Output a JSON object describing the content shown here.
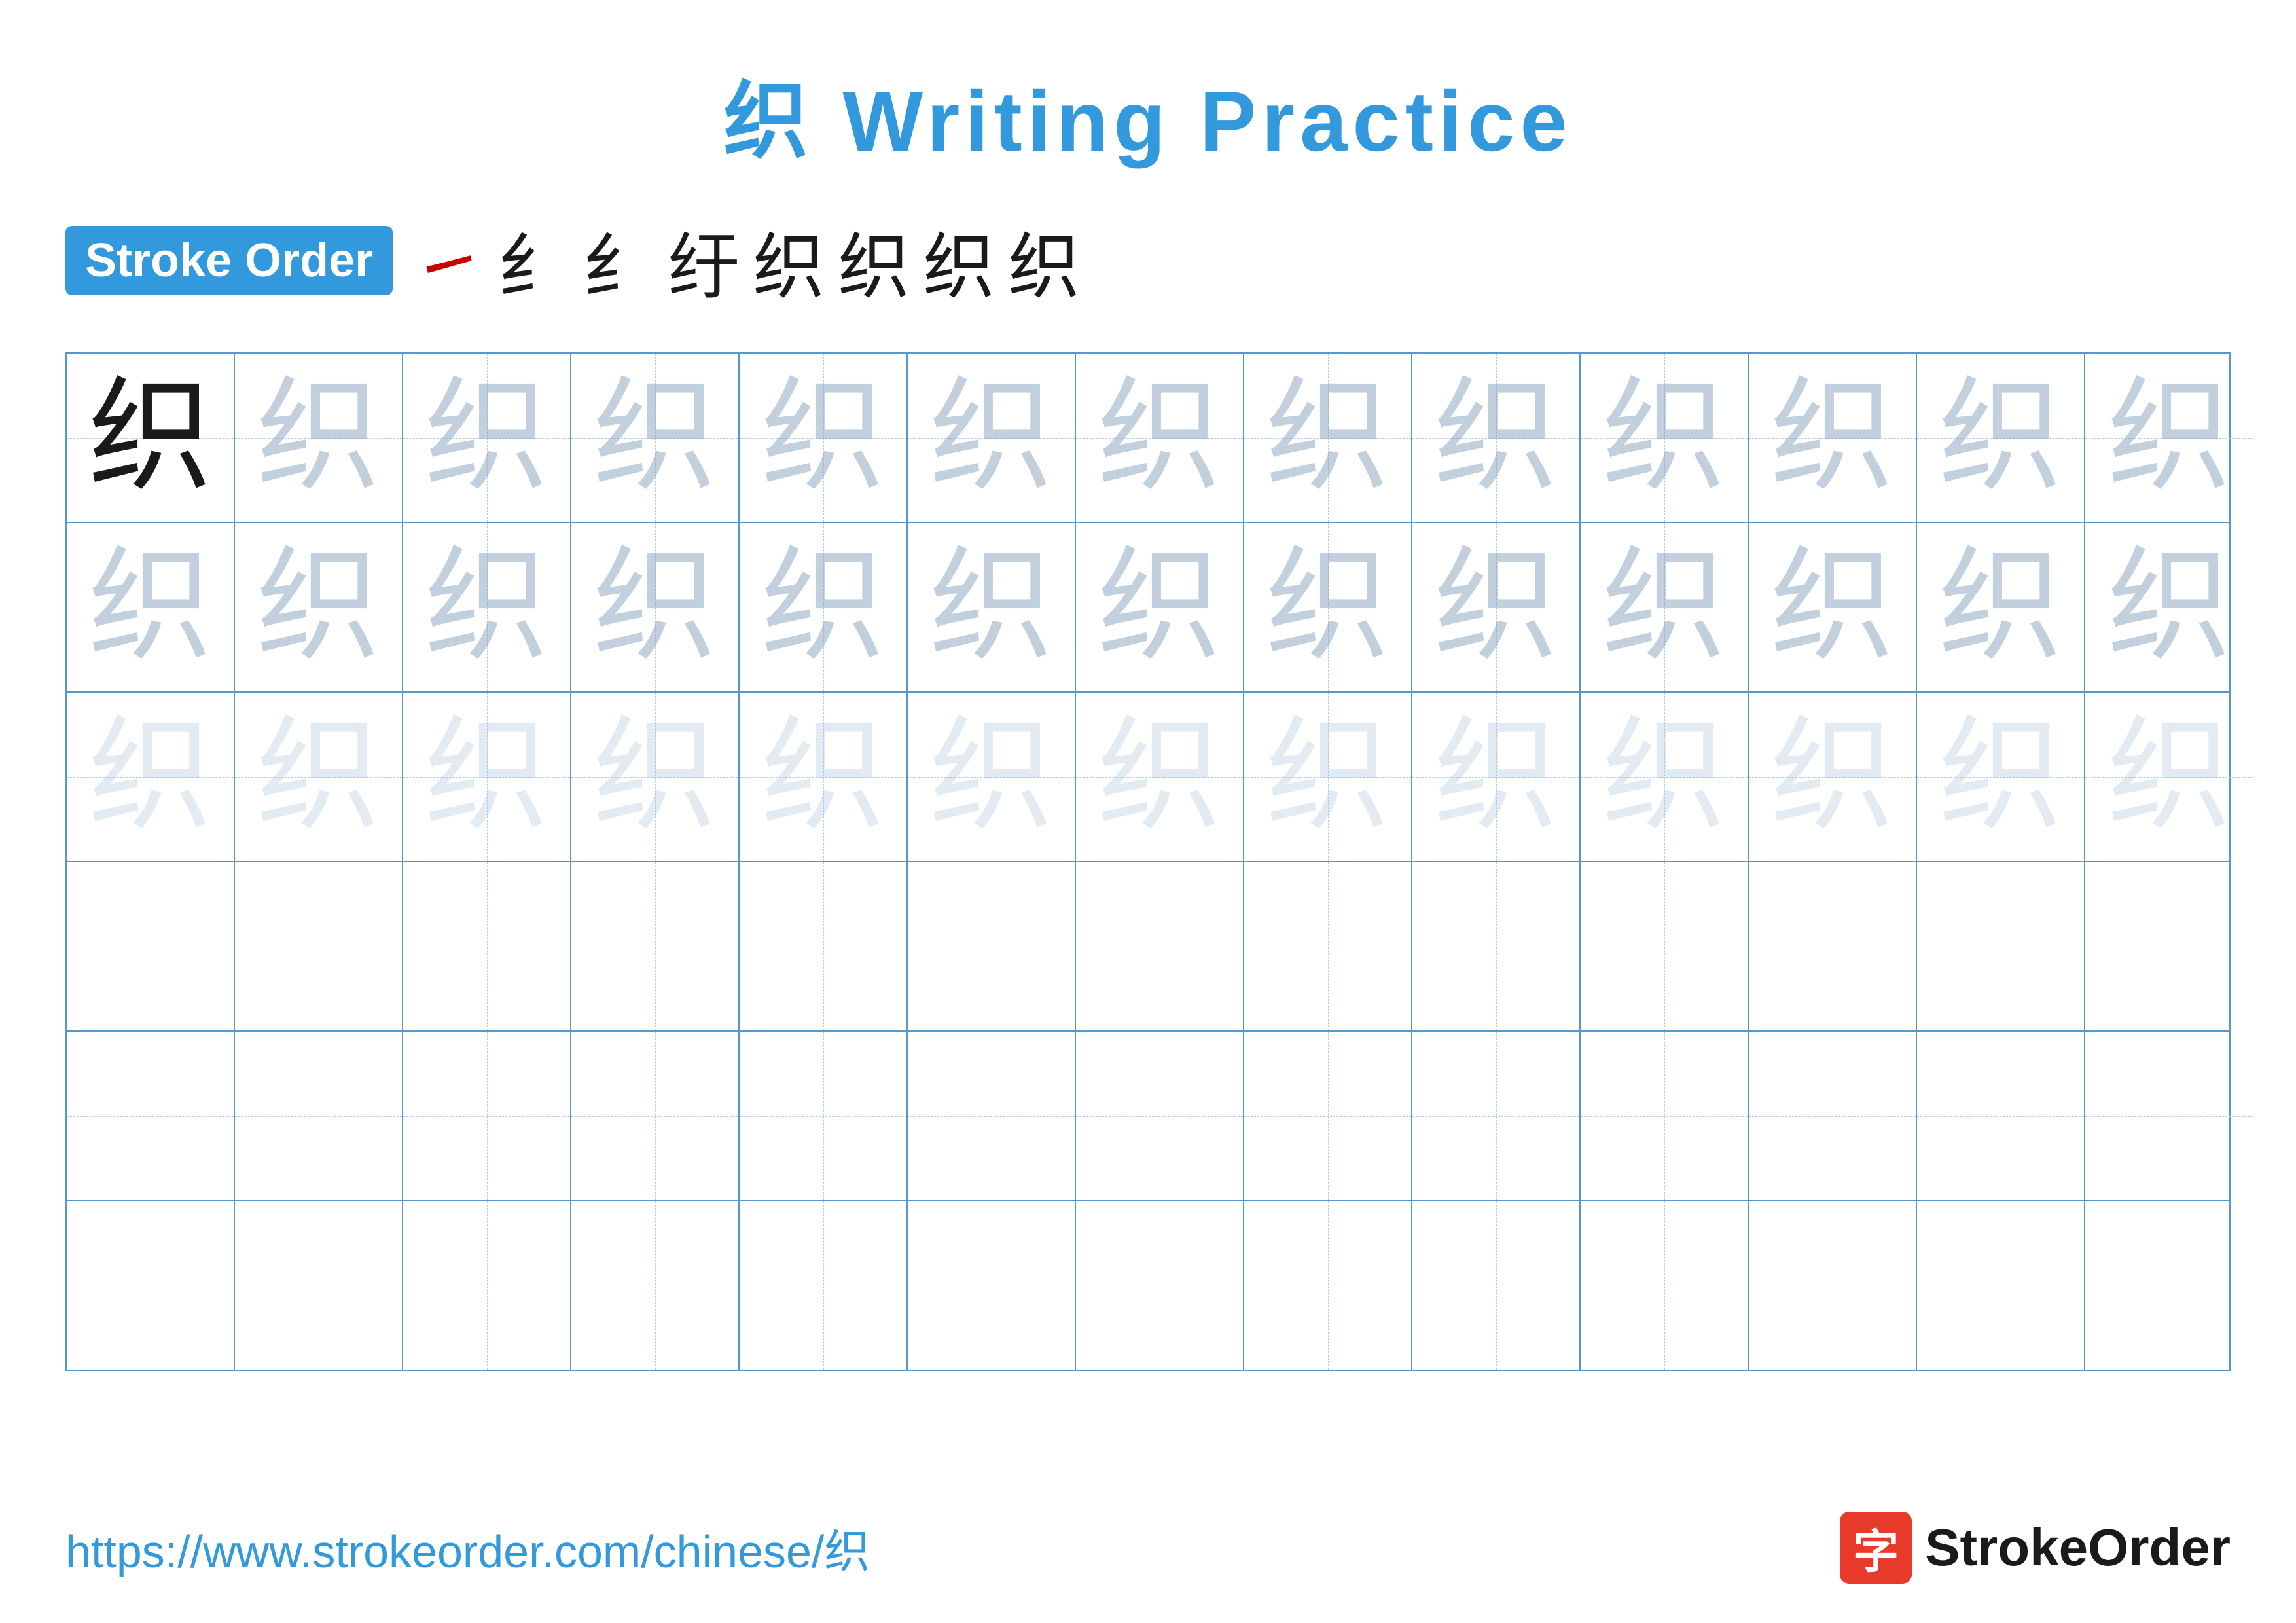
{
  "title": {
    "text": "织 Writing Practice",
    "color": "#3399dd"
  },
  "stroke_order": {
    "badge_label": "Stroke Order",
    "chars": [
      "㇀",
      "纟",
      "纟",
      "纡",
      "织",
      "织",
      "织",
      "织"
    ]
  },
  "grid": {
    "rows": 6,
    "cols": 13,
    "character": "织",
    "row_types": [
      "main_faded",
      "faded_medium",
      "faded_light",
      "empty",
      "empty",
      "empty"
    ]
  },
  "footer": {
    "url": "https://www.strokeorder.com/chinese/织",
    "brand_name": "StrokeOrder",
    "brand_icon": "字"
  }
}
